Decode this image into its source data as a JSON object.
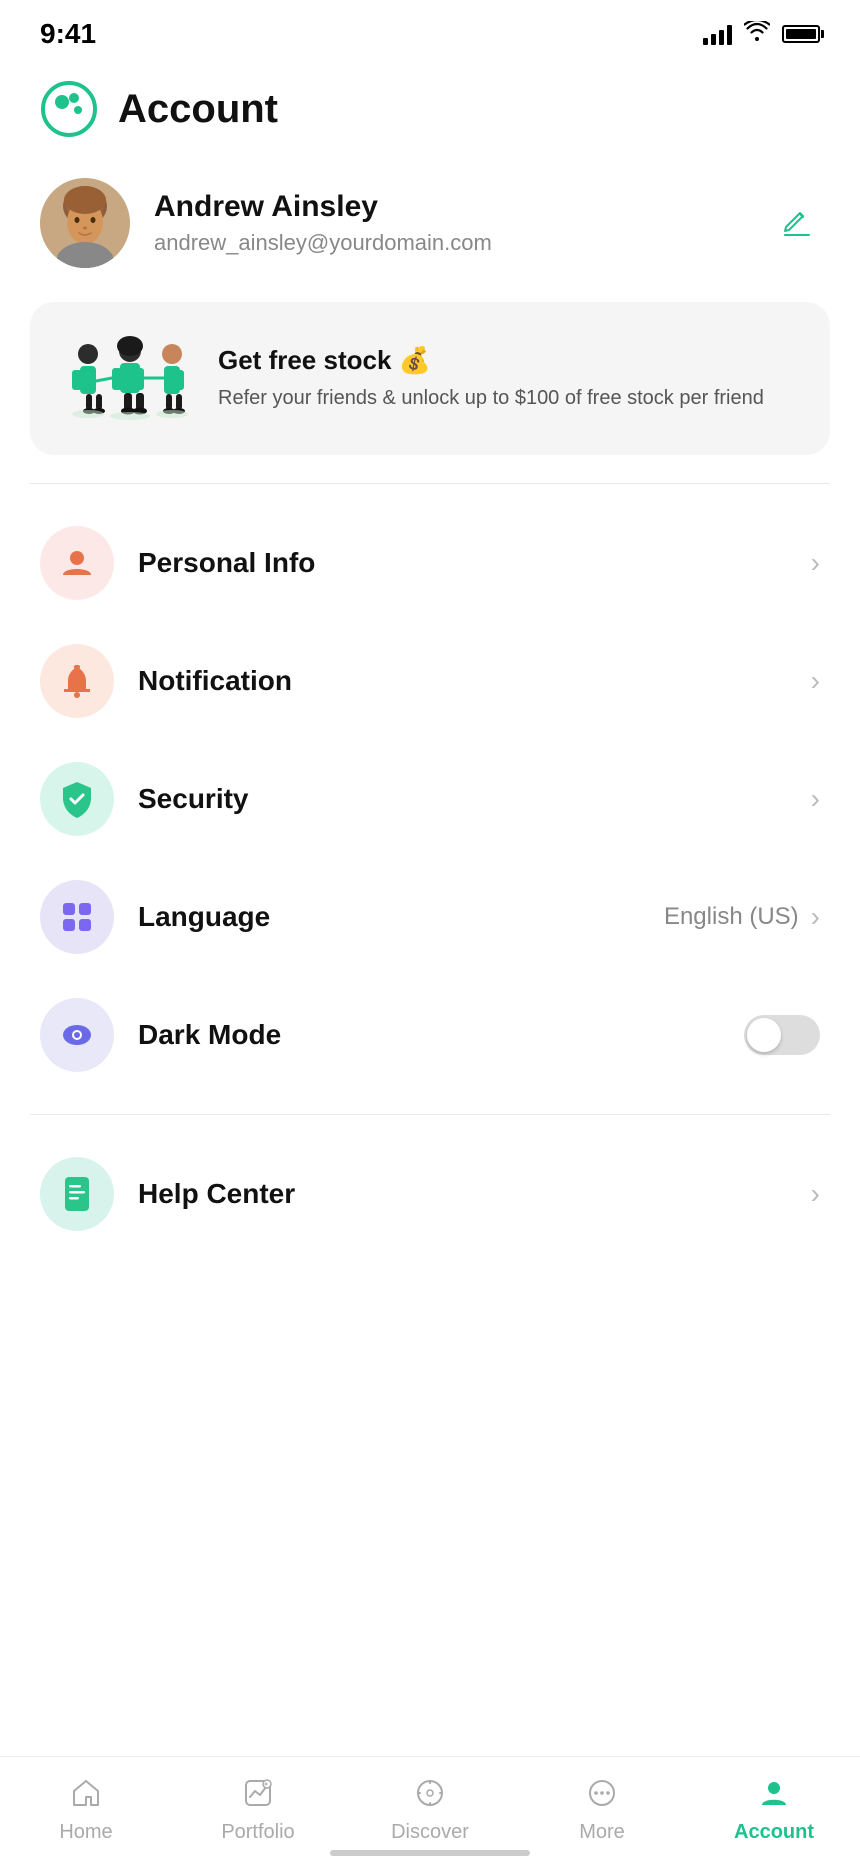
{
  "statusBar": {
    "time": "9:41"
  },
  "header": {
    "title": "Account"
  },
  "profile": {
    "name": "Andrew Ainsley",
    "email": "andrew_ainsley@yourdomain.com",
    "editLabel": "edit"
  },
  "referral": {
    "title": "Get free stock 💰",
    "description": "Refer your friends & unlock up to $100 of free stock per friend"
  },
  "menuItems": [
    {
      "id": "personal-info",
      "label": "Personal Info",
      "iconBg": "orange-bg",
      "iconColor": "#e8724a",
      "iconType": "person",
      "value": "",
      "type": "nav"
    },
    {
      "id": "notification",
      "label": "Notification",
      "iconBg": "peach-bg",
      "iconColor": "#e8724a",
      "iconType": "bell",
      "value": "",
      "type": "nav"
    },
    {
      "id": "security",
      "label": "Security",
      "iconBg": "green-bg",
      "iconColor": "#2bc48a",
      "iconType": "shield",
      "value": "",
      "type": "nav"
    },
    {
      "id": "language",
      "label": "Language",
      "iconBg": "purple-bg",
      "iconColor": "#7b68ee",
      "iconType": "grid",
      "value": "English (US)",
      "type": "nav"
    },
    {
      "id": "dark-mode",
      "label": "Dark Mode",
      "iconBg": "lavender-bg",
      "iconColor": "#6a6ae8",
      "iconType": "eye",
      "value": "",
      "type": "toggle"
    }
  ],
  "section2Items": [
    {
      "id": "help-center",
      "label": "Help Center",
      "iconBg": "teal-bg",
      "iconColor": "#2bc48a",
      "iconType": "doc",
      "value": "",
      "type": "nav"
    }
  ],
  "bottomNav": {
    "items": [
      {
        "id": "home",
        "label": "Home",
        "iconType": "home",
        "active": false
      },
      {
        "id": "portfolio",
        "label": "Portfolio",
        "iconType": "chart",
        "active": false
      },
      {
        "id": "discover",
        "label": "Discover",
        "iconType": "compass",
        "active": false
      },
      {
        "id": "more",
        "label": "More",
        "iconType": "dots",
        "active": false
      },
      {
        "id": "account",
        "label": "Account",
        "iconType": "person-filled",
        "active": true
      }
    ]
  }
}
